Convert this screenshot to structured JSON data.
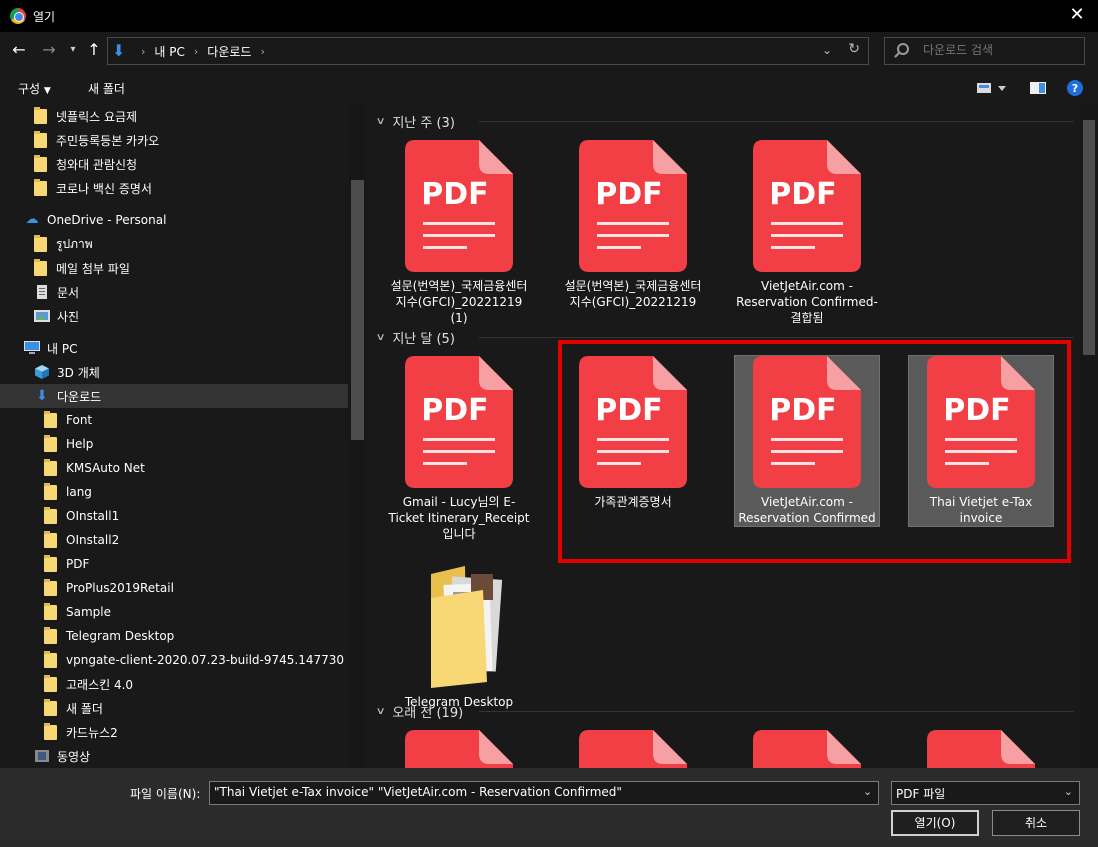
{
  "window": {
    "title": "열기"
  },
  "nav": {
    "breadcrumb": [
      "내 PC",
      "다운로드"
    ],
    "search_placeholder": "다운로드 검색"
  },
  "toolbar": {
    "organize": "구성",
    "new_folder": "새 폴더"
  },
  "sidebar": {
    "items": [
      {
        "label": "넷플릭스 요금제",
        "icon": "folder-icon"
      },
      {
        "label": "주민등록등본 카카오",
        "icon": "folder-icon"
      },
      {
        "label": "청와대 관람신청",
        "icon": "folder-icon"
      },
      {
        "label": "코로나 백신 증명서",
        "icon": "folder-icon"
      },
      {
        "label": "OneDrive - Personal",
        "icon": "onedrive-icon"
      },
      {
        "label": "รูปภาพ",
        "icon": "folder-icon"
      },
      {
        "label": "메일 첨부 파일",
        "icon": "folder-icon"
      },
      {
        "label": "문서",
        "icon": "document-icon"
      },
      {
        "label": "사진",
        "icon": "picture-icon"
      },
      {
        "label": "내 PC",
        "icon": "computer-icon"
      },
      {
        "label": "3D 개체",
        "icon": "cube-icon"
      },
      {
        "label": "다운로드",
        "icon": "download-arrow-icon"
      },
      {
        "label": "Font",
        "icon": "folder-icon"
      },
      {
        "label": "Help",
        "icon": "folder-icon"
      },
      {
        "label": "KMSAuto Net",
        "icon": "folder-icon"
      },
      {
        "label": "lang",
        "icon": "folder-icon"
      },
      {
        "label": "OInstall1",
        "icon": "folder-icon"
      },
      {
        "label": "OInstall2",
        "icon": "folder-icon"
      },
      {
        "label": "PDF",
        "icon": "folder-icon"
      },
      {
        "label": "ProPlus2019Retail",
        "icon": "folder-icon"
      },
      {
        "label": "Sample",
        "icon": "folder-icon"
      },
      {
        "label": "Telegram Desktop",
        "icon": "folder-icon"
      },
      {
        "label": "vpngate-client-2020.07.23-build-9745.147730",
        "icon": "folder-icon"
      },
      {
        "label": "고래스킨 4.0",
        "icon": "folder-icon"
      },
      {
        "label": "새 폴더",
        "icon": "folder-icon"
      },
      {
        "label": "카드뉴스2",
        "icon": "folder-icon"
      },
      {
        "label": "동영상",
        "icon": "video-icon"
      }
    ]
  },
  "groups": [
    {
      "title": "지난 주 (3)",
      "files": [
        {
          "label": "설문(번역본)_국제금융센터지수(GFCI)_20221219 (1)",
          "icon": "pdf-icon"
        },
        {
          "label": "설문(번역본)_국제금융센터지수(GFCI)_20221219",
          "icon": "pdf-icon"
        },
        {
          "label": "VietJetAir.com - Reservation Confirmed-결합됨",
          "icon": "pdf-icon"
        }
      ]
    },
    {
      "title": "지난 달 (5)",
      "files": [
        {
          "label": "Gmail - Lucy님의 E-Ticket Itinerary_Receipt 입니다",
          "icon": "pdf-icon"
        },
        {
          "label": "가족관계증명서",
          "icon": "pdf-icon"
        },
        {
          "label": "VietJetAir.com - Reservation Confirmed",
          "icon": "pdf-icon",
          "selected": true
        },
        {
          "label": "Thai Vietjet e-Tax invoice",
          "icon": "pdf-icon",
          "selected": true
        },
        {
          "label": "Telegram Desktop",
          "icon": "folder-icon"
        }
      ]
    },
    {
      "title": "오래 전 (19)",
      "files": []
    }
  ],
  "pdf_icon_text": "PDF",
  "bottom": {
    "filename_label": "파일 이름(N):",
    "filename_value": "\"Thai Vietjet e-Tax invoice\" \"VietJetAir.com - Reservation Confirmed\"",
    "filetype": "PDF 파일",
    "open_button": "열기(O)",
    "cancel_button": "취소"
  },
  "colors": {
    "pdf_red": "#f23f46",
    "pdf_fold": "#f7a0a3",
    "highlight": "#e50000",
    "folder": "#f8d775",
    "accent_blue": "#3d8fe0"
  }
}
